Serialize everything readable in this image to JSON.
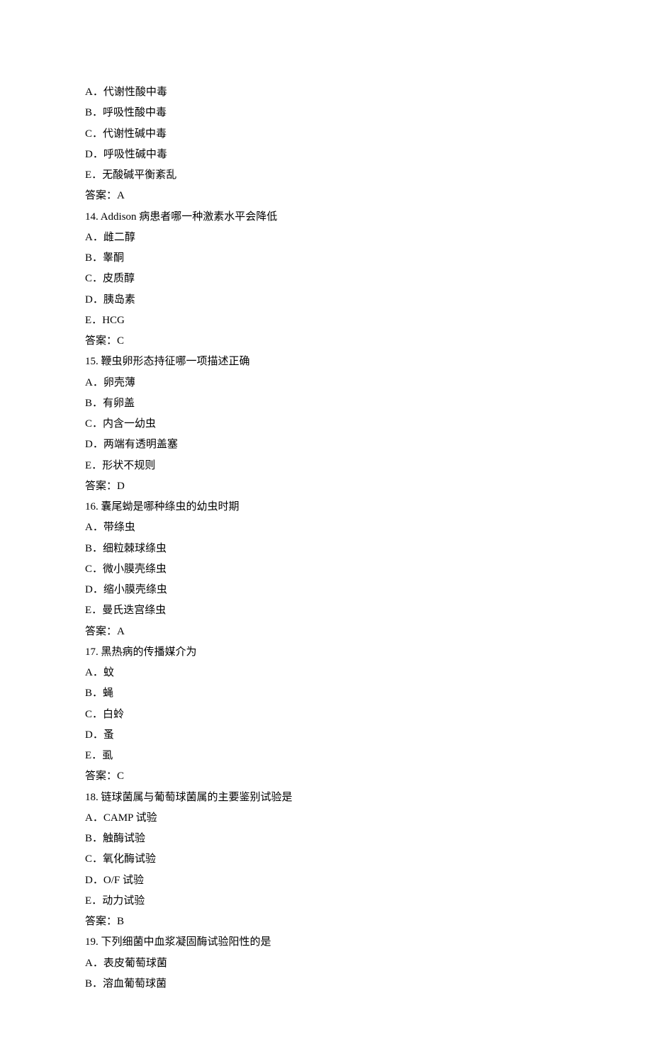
{
  "questions": [
    {
      "id": "q13",
      "options": [
        {
          "letter": "A",
          "text": "代谢性酸中毒"
        },
        {
          "letter": "B",
          "text": "呼吸性酸中毒"
        },
        {
          "letter": "C",
          "text": "代谢性碱中毒"
        },
        {
          "letter": "D",
          "text": "呼吸性碱中毒"
        },
        {
          "letter": "E",
          "text": "无酸碱平衡紊乱"
        }
      ],
      "answer_label": "答案：",
      "answer": "A"
    },
    {
      "id": "q14",
      "number": "14.",
      "stem": "Addison 病患者哪一种激素水平会降低",
      "options": [
        {
          "letter": "A",
          "text": "雌二醇"
        },
        {
          "letter": "B",
          "text": "睾酮"
        },
        {
          "letter": "C",
          "text": "皮质醇"
        },
        {
          "letter": "D",
          "text": "胰岛素"
        },
        {
          "letter": "E",
          "text": "HCG"
        }
      ],
      "answer_label": "答案：",
      "answer": "C"
    },
    {
      "id": "q15",
      "number": "15.",
      "stem": "鞭虫卵形态持征哪一项描述正确",
      "options": [
        {
          "letter": "A",
          "text": "卵壳薄"
        },
        {
          "letter": "B",
          "text": "有卵盖"
        },
        {
          "letter": "C",
          "text": "内含一幼虫"
        },
        {
          "letter": "D",
          "text": "两端有透明盖塞"
        },
        {
          "letter": "E",
          "text": "形状不规则"
        }
      ],
      "answer_label": "答案：",
      "answer": "D"
    },
    {
      "id": "q16",
      "number": "16.",
      "stem": "囊尾蚴是哪种绦虫的幼虫时期",
      "options": [
        {
          "letter": "A",
          "text": "带绦虫"
        },
        {
          "letter": "B",
          "text": "细粒棘球绦虫"
        },
        {
          "letter": "C",
          "text": "微小膜壳绦虫"
        },
        {
          "letter": "D",
          "text": "缩小膜壳绦虫"
        },
        {
          "letter": "E",
          "text": "曼氏迭宫绦虫"
        }
      ],
      "answer_label": "答案：",
      "answer": "A"
    },
    {
      "id": "q17",
      "number": "17.",
      "stem": "黑热病的传播媒介为",
      "options": [
        {
          "letter": "A",
          "text": "蚊"
        },
        {
          "letter": "B",
          "text": "蝇"
        },
        {
          "letter": "C",
          "text": "白蛉"
        },
        {
          "letter": "D",
          "text": "蚤"
        },
        {
          "letter": "E",
          "text": "虱"
        }
      ],
      "answer_label": "答案：",
      "answer": "C"
    },
    {
      "id": "q18",
      "number": "18.",
      "stem": "链球菌属与葡萄球菌属的主要鉴别试验是",
      "options": [
        {
          "letter": "A",
          "text": "CAMP 试验"
        },
        {
          "letter": "B",
          "text": "触酶试验"
        },
        {
          "letter": "C",
          "text": "氧化酶试验"
        },
        {
          "letter": "D",
          "text": "O/F 试验"
        },
        {
          "letter": "E",
          "text": "动力试验"
        }
      ],
      "answer_label": "答案：",
      "answer": "B"
    },
    {
      "id": "q19",
      "number": "19.",
      "stem": "下列细菌中血浆凝固酶试验阳性的是",
      "options": [
        {
          "letter": "A",
          "text": "表皮葡萄球菌"
        },
        {
          "letter": "B",
          "text": "溶血葡萄球菌"
        }
      ]
    }
  ]
}
